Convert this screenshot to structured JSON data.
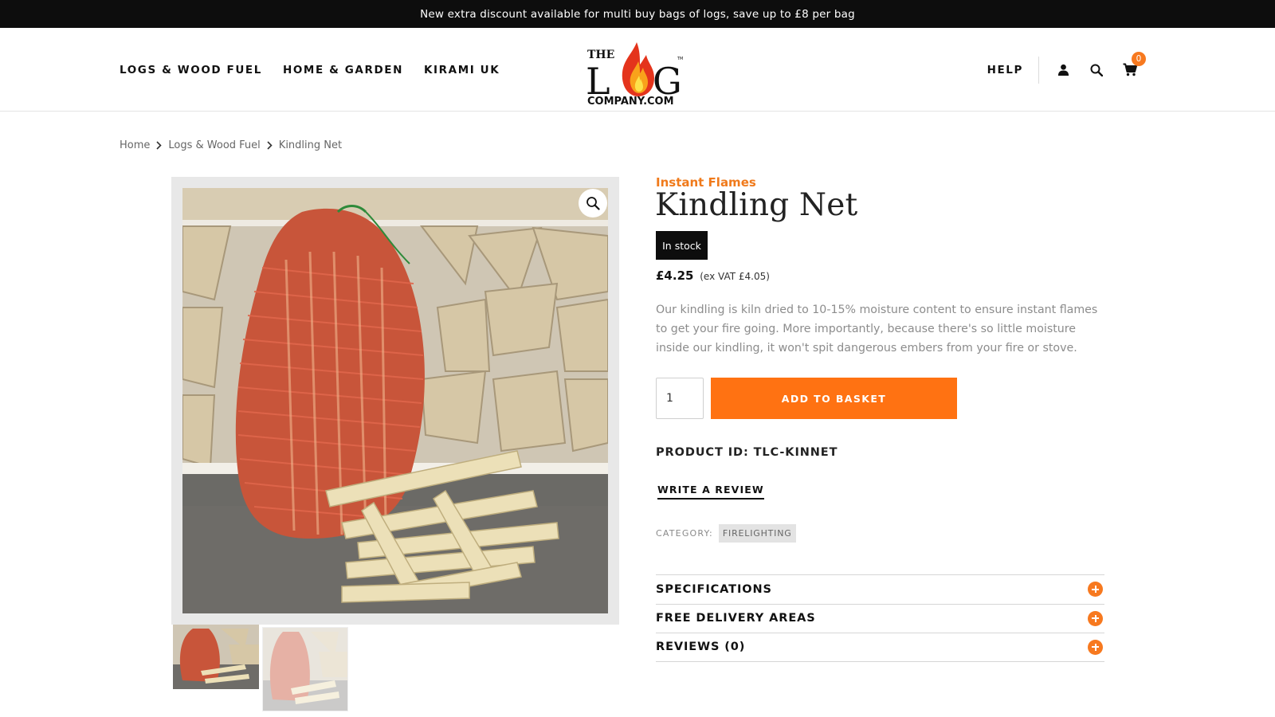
{
  "announcement": "New extra discount available for multi buy bags of logs, save up to £8 per bag",
  "nav": {
    "left": [
      "LOGS & WOOD FUEL",
      "HOME & GARDEN",
      "KIRAMI UK"
    ],
    "help": "HELP",
    "cart_count": "0"
  },
  "logo": {
    "the": "THE",
    "log": "L",
    "g": "G",
    "company": "COMPANY.COM",
    "tm": "TM"
  },
  "breadcrumb": [
    "Home",
    "Logs & Wood Fuel",
    "Kindling Net"
  ],
  "product": {
    "brand": "Instant Flames",
    "title": "Kindling Net",
    "stock": "In stock",
    "price": "£4.25",
    "ex_vat": "(ex VAT £4.05)",
    "description": "Our kindling is kiln dried to 10-15% moisture content to ensure instant flames to get your fire going. More importantly, because there's so little moisture inside our kindling, it won't spit dangerous embers from your fire or stove.",
    "quantity": "1",
    "add_to_basket": "ADD TO BASKET",
    "product_id": "PRODUCT ID: TLC-KINNET",
    "write_review": "WRITE A REVIEW",
    "category_label": "CATEGORY:",
    "category": "FIRELIGHTING"
  },
  "accordion": [
    "SPECIFICATIONS",
    "FREE DELIVERY AREAS",
    "REVIEWS (0)"
  ],
  "icons": {
    "account": "user-icon",
    "search": "search-icon",
    "cart": "cart-icon",
    "zoom": "zoom-icon",
    "chevron": "chevron-right-icon",
    "expand": "plus-circle-icon"
  },
  "colors": {
    "accent": "#ff7212",
    "brand_orange": "#f07a1b",
    "announcement_bg": "#0d0d0d",
    "stock_badge_bg": "#0d0d0d"
  }
}
